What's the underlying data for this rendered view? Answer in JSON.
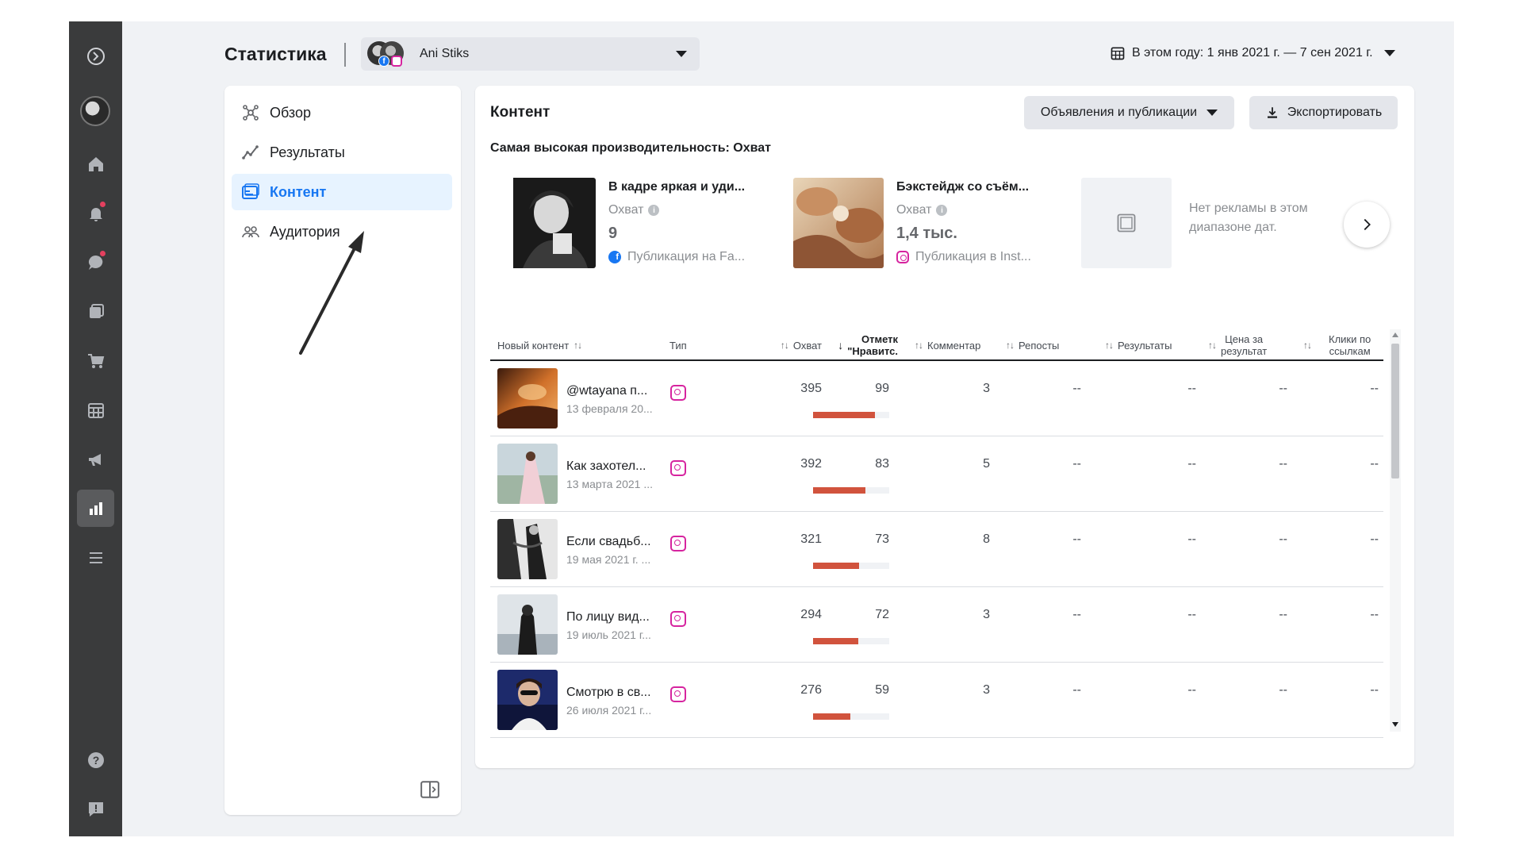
{
  "header": {
    "title": "Статистика",
    "account_name": "Ani Stiks",
    "date_range": "В этом году: 1 янв 2021 г. — 7 сен 2021 г."
  },
  "rail": {
    "icons": [
      "meta-logo-icon",
      "profile-avatar",
      "home-icon",
      "bell-icon",
      "chat-icon",
      "pages-icon",
      "shop-icon",
      "calendar-icon",
      "megaphone-icon",
      "insights-icon",
      "menu-icon",
      "help-icon",
      "feedback-icon"
    ]
  },
  "nav": {
    "items": [
      {
        "label": "Обзор",
        "icon": "overview-icon"
      },
      {
        "label": "Результаты",
        "icon": "results-icon"
      },
      {
        "label": "Контент",
        "icon": "content-icon",
        "active": true
      },
      {
        "label": "Аудитория",
        "icon": "audience-icon"
      }
    ]
  },
  "content": {
    "title": "Контент",
    "filter_label": "Объявления и публикации",
    "export_label": "Экспортировать",
    "top_heading": "Самая высокая производительность: Охват",
    "top_posts": [
      {
        "title": "В кадре яркая и уди...",
        "metric": "Охват",
        "value": "9",
        "source": "Публикация на Fa...",
        "platform": "facebook"
      },
      {
        "title": "Бэкстейдж со съём...",
        "metric": "Охват",
        "value": "1,4 тыс.",
        "source": "Публикация в Inst...",
        "platform": "instagram"
      }
    ],
    "no_ads_text": "Нет рекламы в этом диапазоне дат."
  },
  "table": {
    "columns": {
      "new_content": "Новый контент",
      "type": "Тип",
      "reach": "Охват",
      "likes_l1": "Отметк",
      "likes_l2": "\"Нравитс.",
      "comments": "Комментар",
      "reposts": "Репосты",
      "results": "Результаты",
      "cost_l1": "Цена за",
      "cost_l2": "результат",
      "clicks_l1": "Клики по",
      "clicks_l2": "ссылкам"
    },
    "rows": [
      {
        "title": "@wtayana п...",
        "date": "13 февраля 20...",
        "type": "instagram",
        "reach": "395",
        "likes": "99",
        "likes_fraction": 0.81,
        "comments": "3",
        "reposts": "--",
        "results": "--",
        "cost": "--",
        "clicks": "--"
      },
      {
        "title": "Как захотел...",
        "date": "13 марта 2021 ...",
        "type": "instagram",
        "reach": "392",
        "likes": "83",
        "likes_fraction": 0.69,
        "comments": "5",
        "reposts": "--",
        "results": "--",
        "cost": "--",
        "clicks": "--"
      },
      {
        "title": "Если свадьб...",
        "date": "19 мая 2021 г. ...",
        "type": "instagram",
        "reach": "321",
        "likes": "73",
        "likes_fraction": 0.6,
        "comments": "8",
        "reposts": "--",
        "results": "--",
        "cost": "--",
        "clicks": "--"
      },
      {
        "title": "По лицу вид...",
        "date": "19 июль 2021 г...",
        "type": "instagram",
        "reach": "294",
        "likes": "72",
        "likes_fraction": 0.59,
        "comments": "3",
        "reposts": "--",
        "results": "--",
        "cost": "--",
        "clicks": "--"
      },
      {
        "title": "Смотрю в св...",
        "date": "26 июля 2021 г...",
        "type": "instagram",
        "reach": "276",
        "likes": "59",
        "likes_fraction": 0.49,
        "comments": "3",
        "reposts": "--",
        "results": "--",
        "cost": "--",
        "clicks": "--"
      }
    ]
  },
  "colors": {
    "accent": "#1877f2",
    "bar": "#d1533d",
    "rail": "#3a3b3c",
    "instagram": "#d6249f"
  }
}
